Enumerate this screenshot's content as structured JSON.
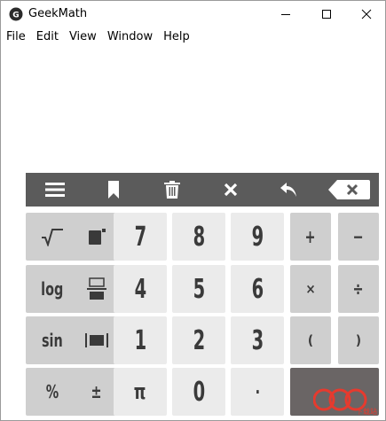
{
  "window": {
    "title": "GeekMath"
  },
  "menu": {
    "items": [
      "File",
      "Edit",
      "View",
      "Window",
      "Help"
    ]
  },
  "toolbar": {
    "icons": [
      "menu-icon",
      "bookmark-icon",
      "trash-icon",
      "clear-icon",
      "undo-icon",
      "backspace-icon"
    ]
  },
  "keys": {
    "row1": [
      "",
      "",
      "7",
      "8",
      "9",
      "+",
      "−"
    ],
    "row2": [
      "log",
      "",
      "4",
      "5",
      "6",
      "×",
      "÷"
    ],
    "row3": [
      "sin",
      "",
      "1",
      "2",
      "3",
      "(",
      ")"
    ],
    "row4": [
      "%",
      "±",
      "π",
      "0",
      "·"
    ]
  },
  "watermark": {
    "text": "pc6",
    "sub": "下载站"
  },
  "colors": {
    "toolbar": "#5b5b5b",
    "key_dark": "#cfcfcf",
    "key_light": "#ebebeb",
    "equals_key": "#6a6565",
    "watermark": "#e63a2e"
  }
}
